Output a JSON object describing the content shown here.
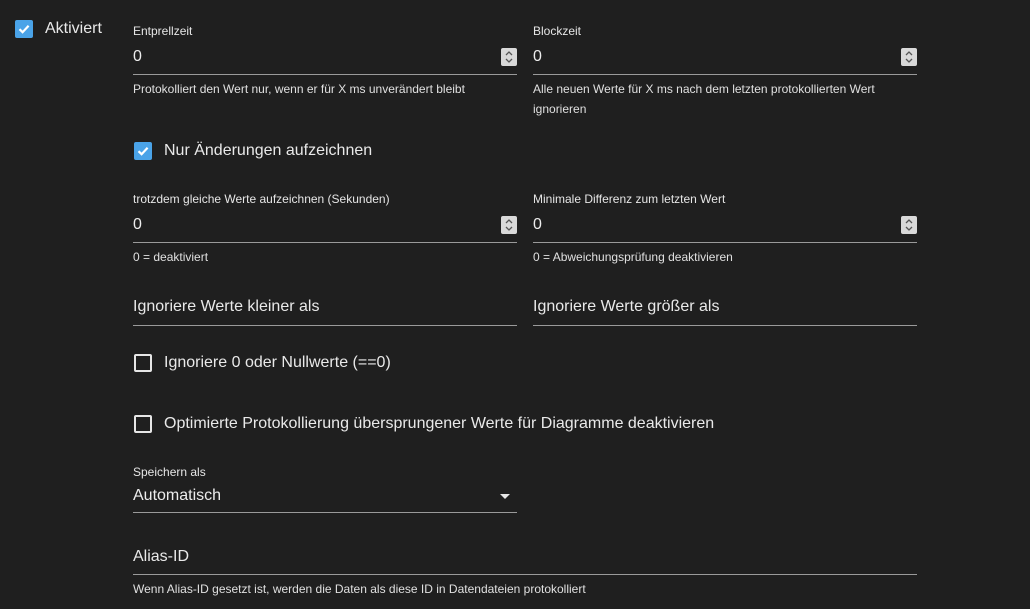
{
  "enabled": {
    "label": "Aktiviert",
    "checked": true
  },
  "debounce": {
    "label": "Entprellzeit",
    "value": "0",
    "helper": "Protokolliert den Wert nur, wenn er für X ms unverändert bleibt"
  },
  "blocktime": {
    "label": "Blockzeit",
    "value": "0",
    "helper": "Alle neuen Werte für X ms nach dem letzten protokollierten Wert ignorieren"
  },
  "changes_only": {
    "label": "Nur Änderungen aufzeichnen",
    "checked": true
  },
  "still_record": {
    "label": "trotzdem gleiche Werte aufzeichnen (Sekunden)",
    "value": "0",
    "helper": "0 = deaktiviert"
  },
  "min_diff": {
    "label": "Minimale Differenz zum letzten Wert",
    "value": "0",
    "helper": "0 = Abweichungsprüfung deaktivieren"
  },
  "ignore_below": {
    "placeholder": "Ignoriere Werte kleiner als"
  },
  "ignore_above": {
    "placeholder": "Ignoriere Werte größer als"
  },
  "ignore_zero": {
    "label": "Ignoriere 0 oder Nullwerte (==0)",
    "checked": false
  },
  "disable_skipped": {
    "label": "Optimierte Protokollierung übersprungener Werte für Diagramme deaktivieren",
    "checked": false
  },
  "store_as": {
    "label": "Speichern als",
    "value": "Automatisch"
  },
  "alias": {
    "placeholder": "Alias-ID",
    "helper": "Wenn Alias-ID gesetzt ist, werden die Daten als diese ID in Datendateien protokolliert"
  },
  "colors": {
    "accent": "#4aa3e8",
    "background": "#1f1f1f"
  }
}
